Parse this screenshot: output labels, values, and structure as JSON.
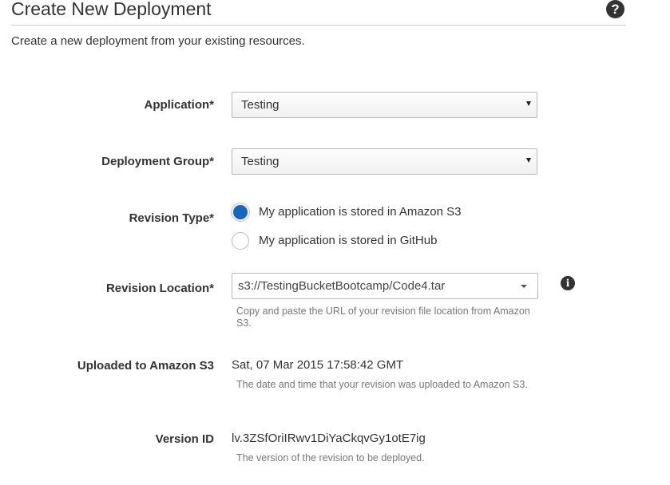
{
  "header": {
    "title": "Create New Deployment",
    "help_icon": "question-circle-icon",
    "help_glyph": "?",
    "subtitle": "Create a new deployment from your existing resources."
  },
  "form": {
    "application": {
      "label": "Application*",
      "value": "Testing"
    },
    "deployment_group": {
      "label": "Deployment Group*",
      "value": "Testing"
    },
    "revision_type": {
      "label": "Revision Type*",
      "options": [
        {
          "label": "My application is stored in Amazon S3",
          "selected": true
        },
        {
          "label": "My application is stored in GitHub",
          "selected": false
        }
      ]
    },
    "revision_location": {
      "label": "Revision Location*",
      "value": "s3://TestingBucketBootcamp/Code4.tar",
      "help": "Copy and paste the URL of your revision file location from Amazon S3.",
      "info_icon": "info-circle-icon",
      "info_glyph": "i"
    },
    "uploaded": {
      "label": "Uploaded to Amazon S3",
      "value": "Sat, 07 Mar 2015 17:58:42 GMT",
      "help": "The date and time that your revision was uploaded to Amazon S3."
    },
    "version_id": {
      "label": "Version ID",
      "value": "lv.3ZSfOriIRwv1DiYaCkqvGy1otE7ig",
      "help": "The version of the revision to be deployed."
    }
  },
  "colors": {
    "radio_selected": "#1b66b8",
    "text": "#333333",
    "help_text": "#777777"
  }
}
